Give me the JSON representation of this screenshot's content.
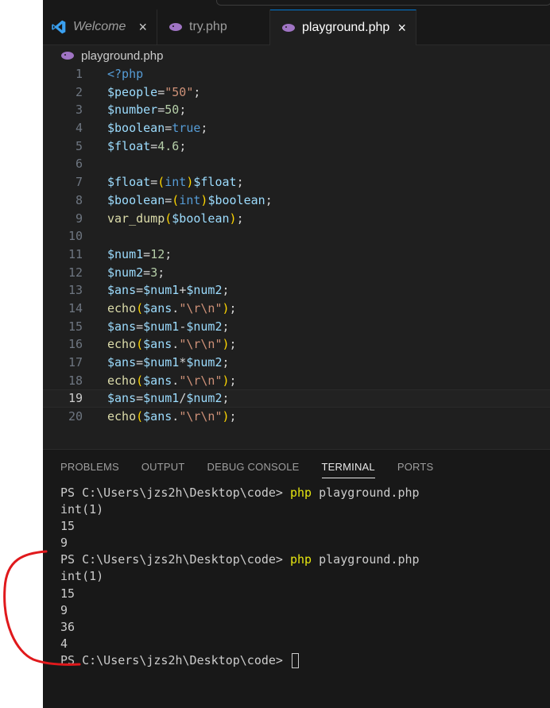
{
  "tabs": [
    {
      "label": "Welcome",
      "icon": "vscode-icon",
      "close": "×",
      "active": false
    },
    {
      "label": "try.php",
      "icon": "php-elephant-icon",
      "active": false
    },
    {
      "label": "playground.php",
      "icon": "php-elephant-icon",
      "close": "×",
      "active": true
    }
  ],
  "breadcrumb": {
    "file": "playground.php",
    "icon": "php-elephant-icon"
  },
  "editor": {
    "current_line": 19,
    "lines": [
      {
        "n": "1",
        "text": "<?php"
      },
      {
        "n": "2",
        "text": "$people=\"50\";"
      },
      {
        "n": "3",
        "text": "$number=50;"
      },
      {
        "n": "4",
        "text": "$boolean=true;"
      },
      {
        "n": "5",
        "text": "$float=4.6;"
      },
      {
        "n": "6",
        "text": ""
      },
      {
        "n": "7",
        "text": "$float=(int)$float;"
      },
      {
        "n": "8",
        "text": "$boolean=(int)$boolean;"
      },
      {
        "n": "9",
        "text": "var_dump($boolean);"
      },
      {
        "n": "10",
        "text": ""
      },
      {
        "n": "11",
        "text": "$num1=12;"
      },
      {
        "n": "12",
        "text": "$num2=3;"
      },
      {
        "n": "13",
        "text": "$ans=$num1+$num2;"
      },
      {
        "n": "14",
        "text": "echo($ans.\"\\r\\n\");"
      },
      {
        "n": "15",
        "text": "$ans=$num1-$num2;"
      },
      {
        "n": "16",
        "text": "echo($ans.\"\\r\\n\");"
      },
      {
        "n": "17",
        "text": "$ans=$num1*$num2;"
      },
      {
        "n": "18",
        "text": "echo($ans.\"\\r\\n\");"
      },
      {
        "n": "19",
        "text": "$ans=$num1/$num2;"
      },
      {
        "n": "20",
        "text": "echo($ans.\"\\r\\n\");"
      }
    ]
  },
  "panel": {
    "tabs": [
      "PROBLEMS",
      "OUTPUT",
      "DEBUG CONSOLE",
      "TERMINAL",
      "PORTS"
    ],
    "active_tab": "TERMINAL",
    "prompt": "PS C:\\Users\\jzs2h\\Desktop\\code> ",
    "command": "php",
    "arg": " playground.php",
    "output_1": [
      "int(1)",
      "15",
      "9"
    ],
    "output_2": [
      "int(1)",
      "15",
      "9",
      "36",
      "4"
    ]
  },
  "colors": {
    "editor_bg": "#1f1f1f",
    "panel_bg": "#181818",
    "accent": "#0078d4",
    "annotation_red": "#e0191c"
  }
}
